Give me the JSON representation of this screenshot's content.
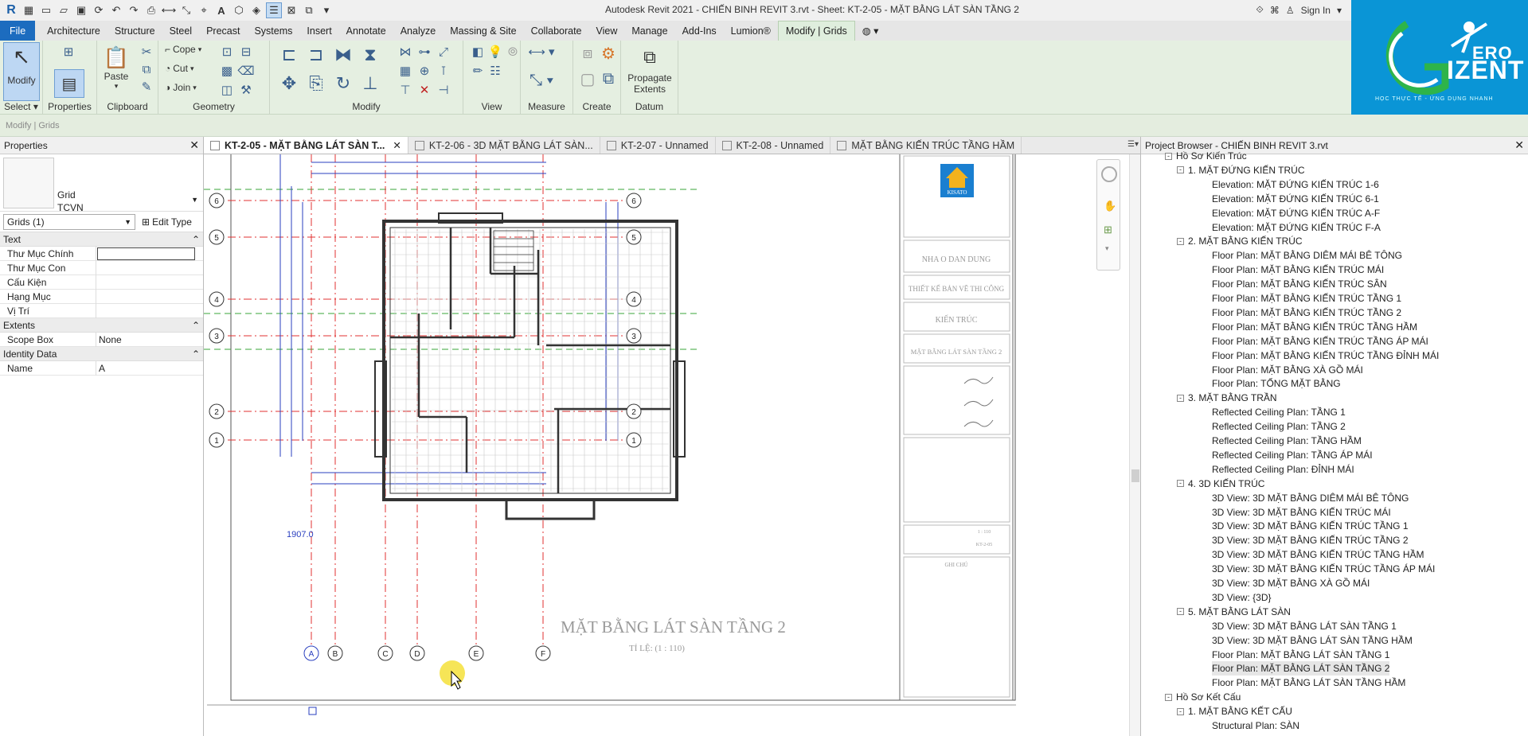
{
  "app": {
    "title": "Autodesk Revit 2021 - CHIẾN BINH REVIT 3.rvt - Sheet: KT-2-05 - MẶT BẰNG LÁT SÀN TẦNG 2",
    "sign_in": "Sign In"
  },
  "logo": {
    "ero": "ERO",
    "izent": "IZENT",
    "tagline": "HỌC THỰC TẾ - ỨNG DỤNG NHANH"
  },
  "ribbon_tabs": [
    "File",
    "Architecture",
    "Structure",
    "Steel",
    "Precast",
    "Systems",
    "Insert",
    "Annotate",
    "Analyze",
    "Massing & Site",
    "Collaborate",
    "View",
    "Manage",
    "Add-Ins",
    "Lumion®",
    "Modify | Grids"
  ],
  "ribbon": {
    "panels": {
      "select": "Select",
      "properties": "Properties",
      "clipboard": "Clipboard",
      "geometry": "Geometry",
      "modify": "Modify",
      "view": "View",
      "measure": "Measure",
      "create": "Create",
      "datum": "Datum"
    },
    "modify_label": "Modify",
    "paste_label": "Paste",
    "cope_label": "Cope",
    "cut_label": "Cut",
    "join_label": "Join",
    "propagate_label": "Propagate Extents"
  },
  "options_bar": {
    "context": "Modify | Grids"
  },
  "properties": {
    "title": "Properties",
    "type_name": "Grid",
    "type_sub": "TCVN",
    "selector": "Grids (1)",
    "edit_type": "Edit Type",
    "groups": [
      {
        "name": "Text",
        "rows": [
          {
            "key": "Thư Mục Chính",
            "value": ""
          },
          {
            "key": "Thư Mục Con",
            "value": ""
          },
          {
            "key": "Cấu Kiện",
            "value": ""
          },
          {
            "key": "Hạng Mục",
            "value": ""
          },
          {
            "key": "Vị Trí",
            "value": ""
          }
        ]
      },
      {
        "name": "Extents",
        "rows": [
          {
            "key": "Scope Box",
            "value": "None"
          }
        ]
      },
      {
        "name": "Identity Data",
        "rows": [
          {
            "key": "Name",
            "value": "A"
          }
        ]
      }
    ]
  },
  "view_tabs": [
    "KT-2-05 - MẶT BẰNG LÁT SÀN T...",
    "KT-2-06 - 3D MẶT BẰNG LÁT SÀN...",
    "KT-2-07 - Unnamed",
    "KT-2-08 - Unnamed",
    "MẶT BẰNG KIẾN TRÚC TẦNG HẦM"
  ],
  "drawing": {
    "sheet_title": "MẶT BẰNG LÁT SÀN TẦNG 2",
    "scale": "TỈ LỆ: (1 : 110)",
    "dim_readout": "1907.0",
    "grid_cols": [
      "A",
      "B",
      "C",
      "D",
      "E",
      "F"
    ],
    "grid_rows": [
      "6",
      "5",
      "4",
      "3",
      "2",
      "1"
    ],
    "title_block": {
      "company": "KISATO",
      "project": "NHA O DAN DUNG",
      "phase": "THIẾT KẾ BẢN VẼ THI CÔNG",
      "discipline": "KIẾN TRÚC",
      "drawing_name": "MẶT BẰNG LÁT SÀN TẦNG 2",
      "notes_label": "GHI CHÚ",
      "sheet_no": "KT-2-05",
      "scale_value": "1 : 110"
    }
  },
  "project_browser": {
    "title": "Project Browser - CHIẾN BINH REVIT 3.rvt",
    "nodes": [
      {
        "level": 0,
        "label": "Hồ Sơ Kiến Trúc",
        "toggle": "-"
      },
      {
        "level": 1,
        "label": "1. MẶT ĐỨNG KIẾN TRÚC",
        "toggle": "-"
      },
      {
        "level": 2,
        "label": "Elevation: MẶT ĐỨNG KIẾN TRÚC 1-6"
      },
      {
        "level": 2,
        "label": "Elevation: MẶT ĐỨNG KIẾN TRÚC 6-1"
      },
      {
        "level": 2,
        "label": "Elevation: MẶT ĐỨNG KIẾN TRÚC A-F"
      },
      {
        "level": 2,
        "label": "Elevation: MẶT ĐỨNG KIẾN TRÚC F-A"
      },
      {
        "level": 1,
        "label": "2. MẶT BẰNG KIẾN TRÚC",
        "toggle": "-"
      },
      {
        "level": 2,
        "label": "Floor Plan: MẶT BẰNG DIÊM MÁI BÊ TÔNG"
      },
      {
        "level": 2,
        "label": "Floor Plan: MẶT BẰNG KIẾN TRÚC MÁI"
      },
      {
        "level": 2,
        "label": "Floor Plan: MẶT BẰNG KIẾN TRÚC SÂN"
      },
      {
        "level": 2,
        "label": "Floor Plan: MẶT BẰNG KIẾN TRÚC TẦNG 1"
      },
      {
        "level": 2,
        "label": "Floor Plan: MẶT BẰNG KIẾN TRÚC TẦNG 2"
      },
      {
        "level": 2,
        "label": "Floor Plan: MẶT BẰNG KIẾN TRÚC TẦNG HẦM"
      },
      {
        "level": 2,
        "label": "Floor Plan: MẶT BẰNG KIẾN TRÚC TẦNG ÁP MÁI"
      },
      {
        "level": 2,
        "label": "Floor Plan: MẶT BẰNG KIẾN TRÚC TẦNG ĐỈNH MÁI"
      },
      {
        "level": 2,
        "label": "Floor Plan: MẶT BẰNG XÀ GỒ MÁI"
      },
      {
        "level": 2,
        "label": "Floor Plan: TỔNG MẶT BẰNG"
      },
      {
        "level": 1,
        "label": "3. MẶT BẰNG TRẦN",
        "toggle": "-"
      },
      {
        "level": 2,
        "label": "Reflected Ceiling Plan: TẦNG 1"
      },
      {
        "level": 2,
        "label": "Reflected Ceiling Plan: TẦNG 2"
      },
      {
        "level": 2,
        "label": "Reflected Ceiling Plan: TẦNG HẦM"
      },
      {
        "level": 2,
        "label": "Reflected Ceiling Plan: TẦNG ÁP MÁI"
      },
      {
        "level": 2,
        "label": "Reflected Ceiling Plan: ĐỈNH MÁI"
      },
      {
        "level": 1,
        "label": "4. 3D KIẾN TRÚC",
        "toggle": "-"
      },
      {
        "level": 2,
        "label": "3D View: 3D MẶT BẰNG DIÊM MÁI BÊ TÔNG"
      },
      {
        "level": 2,
        "label": "3D View: 3D MẶT BẰNG KIẾN TRÚC MÁI"
      },
      {
        "level": 2,
        "label": "3D View: 3D MẶT BẰNG KIẾN TRÚC TẦNG 1"
      },
      {
        "level": 2,
        "label": "3D View: 3D MẶT BẰNG KIẾN TRÚC TẦNG 2"
      },
      {
        "level": 2,
        "label": "3D View: 3D MẶT BẰNG KIẾN TRÚC TẦNG HẦM"
      },
      {
        "level": 2,
        "label": "3D View: 3D MẶT BẰNG KIẾN TRÚC TẦNG ÁP MÁI"
      },
      {
        "level": 2,
        "label": "3D View: 3D MẶT BẰNG XÀ GỒ MÁI"
      },
      {
        "level": 2,
        "label": "3D View: {3D}"
      },
      {
        "level": 1,
        "label": "5. MẶT BẰNG LÁT SÀN",
        "toggle": "-"
      },
      {
        "level": 2,
        "label": "3D View: 3D MẶT BẰNG LÁT SÀN TẦNG 1"
      },
      {
        "level": 2,
        "label": "3D View: 3D MẶT BẰNG LÁT SÀN TẦNG HẦM"
      },
      {
        "level": 2,
        "label": "Floor Plan: MẶT BẰNG LÁT SÀN TẦNG 1"
      },
      {
        "level": 2,
        "label": "Floor Plan: MẶT BẰNG LÁT SÀN TẦNG 2",
        "highlight": true
      },
      {
        "level": 2,
        "label": "Floor Plan: MẶT BẰNG LÁT SÀN TẦNG HẦM"
      },
      {
        "level": 0,
        "label": "Hồ Sơ Kết Cấu",
        "toggle": "-"
      },
      {
        "level": 1,
        "label": "1. MẶT BẰNG KẾT CẤU",
        "toggle": "-"
      },
      {
        "level": 2,
        "label": "Structural Plan: SÀN"
      }
    ]
  },
  "colors": {
    "file_tab": "#1c6cbf",
    "ribbon": "#e5efe1",
    "logo_bg": "#0a95d6",
    "grid_line": "#e03030",
    "dim_line": "#2a3fbf"
  }
}
